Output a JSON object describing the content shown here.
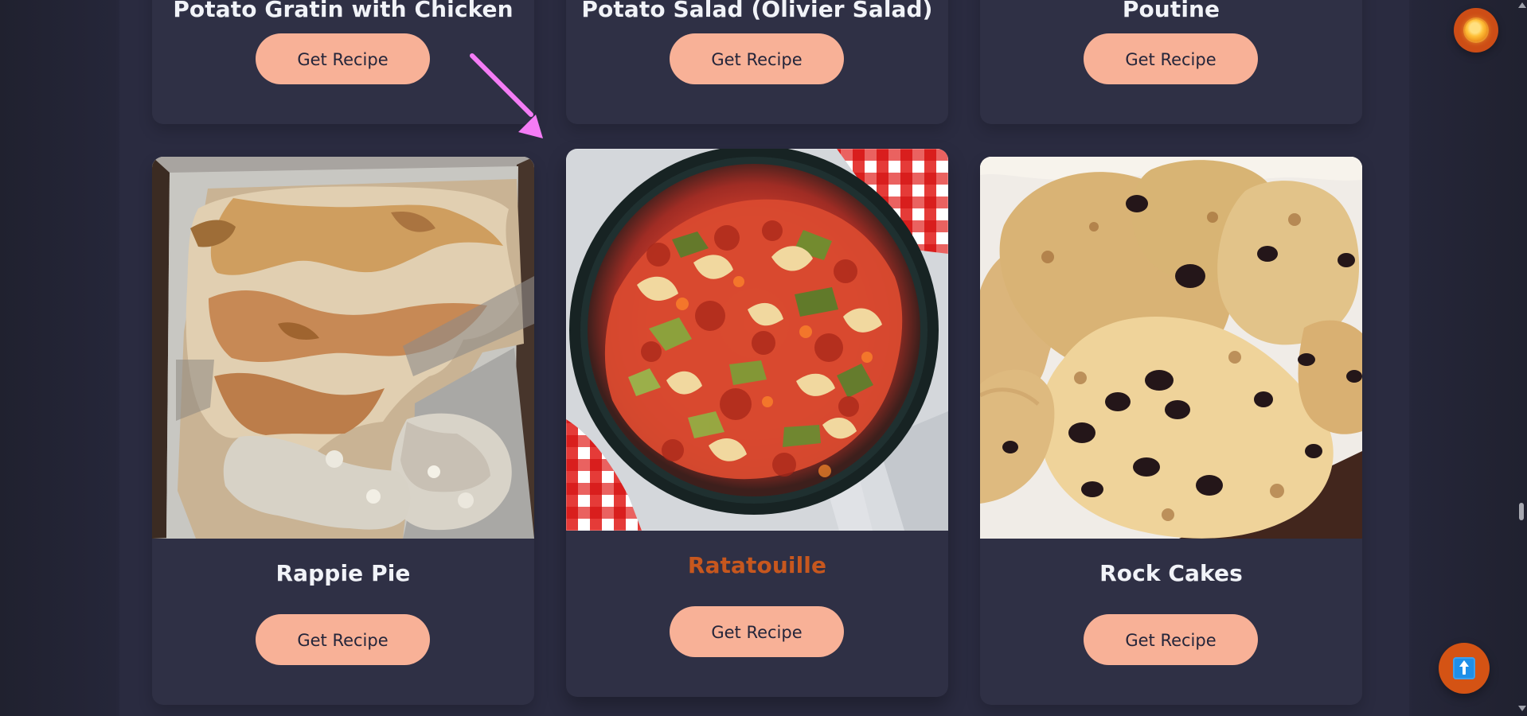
{
  "recipes": {
    "top_row": [
      {
        "title": "Potato Gratin with Chicken",
        "button_label": "Get Recipe"
      },
      {
        "title": "Potato Salad (Olivier Salad)",
        "button_label": "Get Recipe"
      },
      {
        "title": "Poutine",
        "button_label": "Get Recipe"
      }
    ],
    "bottom_row": [
      {
        "title": "Rappie Pie",
        "button_label": "Get Recipe",
        "image_alt": "rappie-pie-photo"
      },
      {
        "title": "Ratatouille",
        "button_label": "Get Recipe",
        "image_alt": "ratatouille-photo"
      },
      {
        "title": "Rock Cakes",
        "button_label": "Get Recipe",
        "image_alt": "rock-cakes-photo"
      }
    ]
  },
  "colors": {
    "background": "#2a2b40",
    "card": "#2f3045",
    "button": "#f8b197",
    "accent": "#c7571e",
    "arrow": "#f47cf5"
  },
  "controls": {
    "theme_icon": "sun-icon",
    "scroll_top_icon": "arrow-up-icon"
  }
}
